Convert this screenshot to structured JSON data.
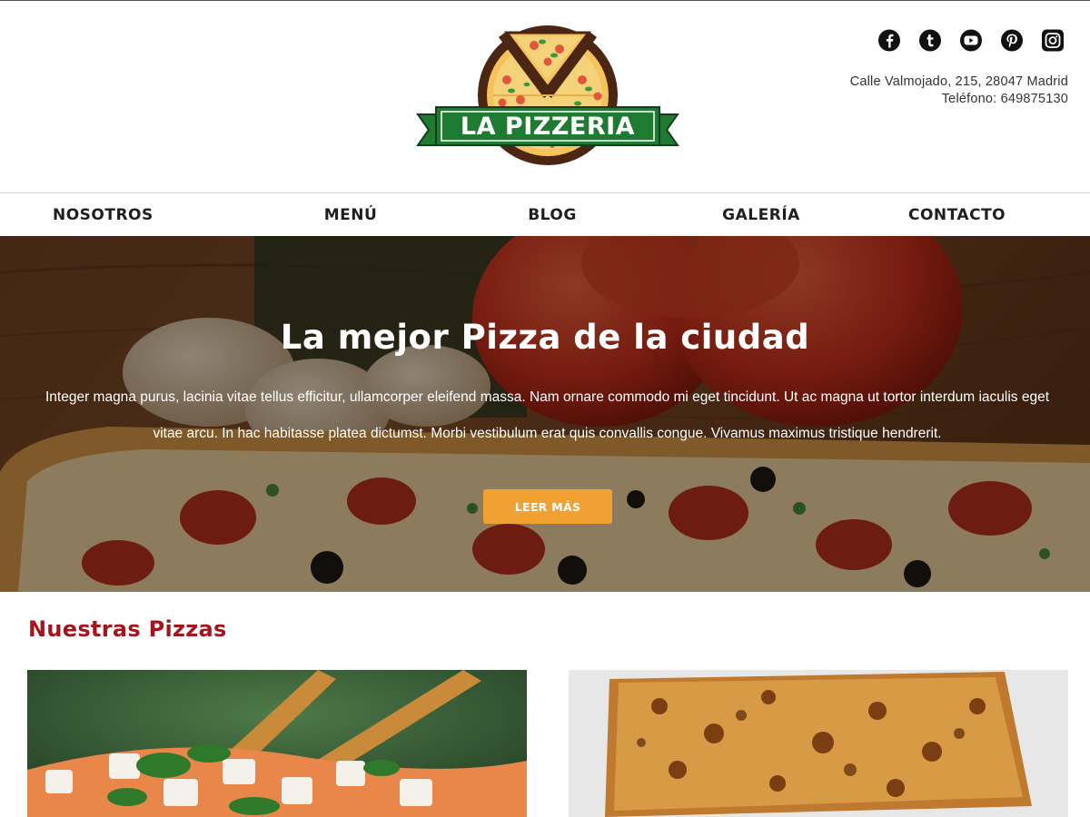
{
  "brand": {
    "name": "LA PIZZERIA",
    "colors": {
      "banner_green": "#1f7a32",
      "pizza_dark": "#4a2613",
      "crust": "#f6c25b",
      "accent_orange": "#f0a132",
      "section_red": "#a3161e"
    }
  },
  "social": [
    {
      "icon": "facebook-icon"
    },
    {
      "icon": "tumblr-icon"
    },
    {
      "icon": "youtube-icon"
    },
    {
      "icon": "pinterest-icon"
    },
    {
      "icon": "instagram-icon"
    }
  ],
  "contact": {
    "address": "Calle Valmojado, 215, 28047 Madrid",
    "phone": "Teléfono: 649875130"
  },
  "nav": {
    "items": [
      {
        "label": "NOSOTROS"
      },
      {
        "label": "MENÚ"
      },
      {
        "label": "BLOG"
      },
      {
        "label": "GALERÍA"
      },
      {
        "label": "CONTACTO"
      }
    ]
  },
  "hero": {
    "title": "La mejor Pizza de la ciudad",
    "text": "Integer magna purus, lacinia vitae tellus efficitur, ullamcorper eleifend massa. Nam ornare commodo mi eget tincidunt. Ut ac magna ut tortor interdum iaculis eget vitae arcu. In hac habitasse platea dictumst. Morbi vestibulum erat quis convallis congue. Vivamus maximus tristique hendrerit.",
    "button": "LEER MÁS"
  },
  "pizzas": {
    "title": "Nuestras Pizzas"
  }
}
